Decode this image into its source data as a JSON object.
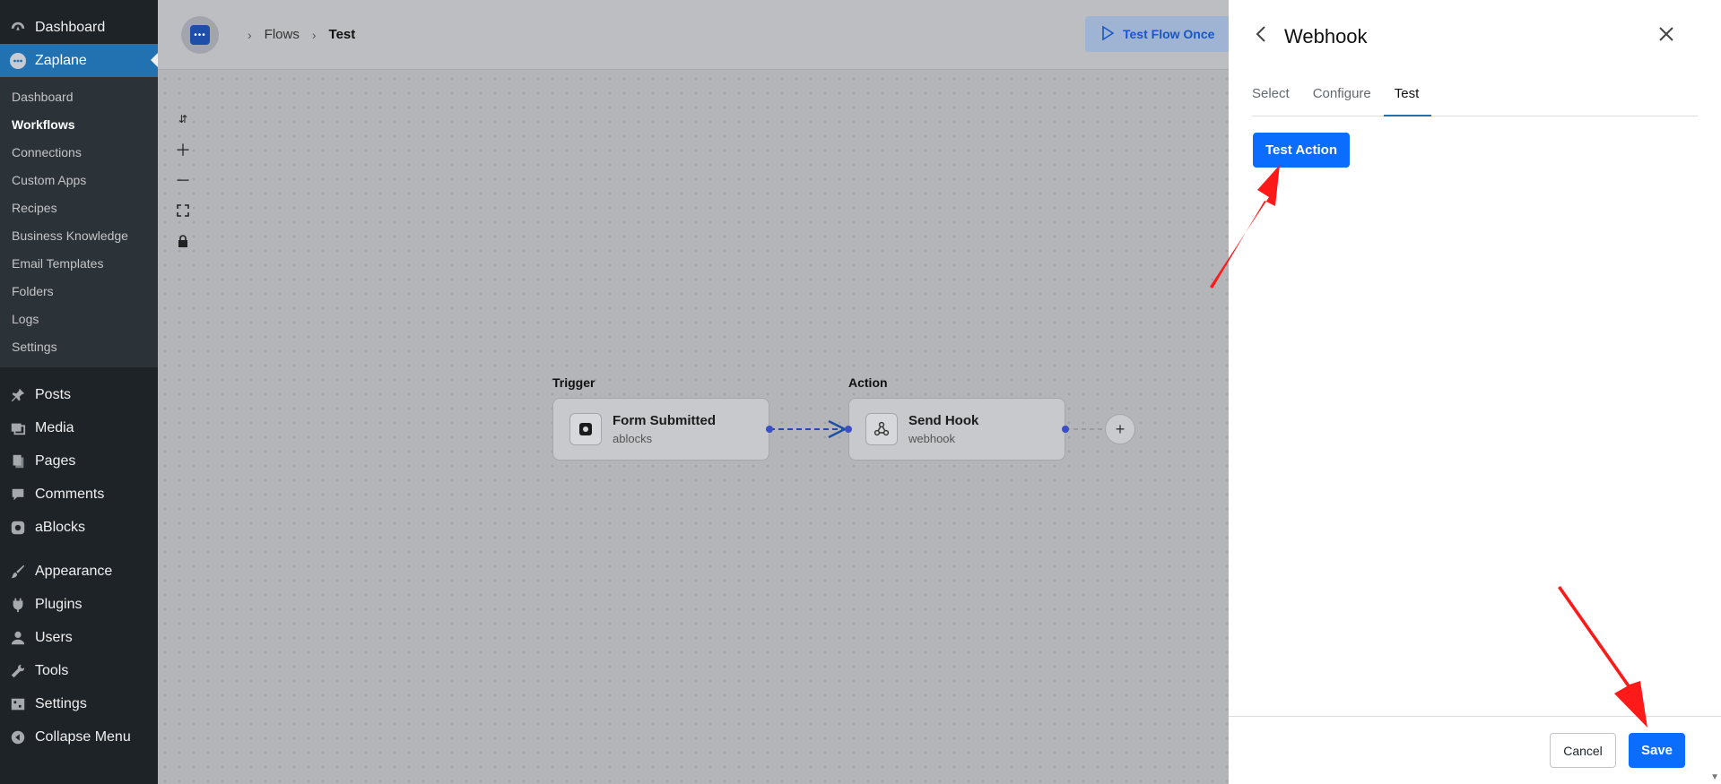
{
  "sidebar": {
    "top_items": [
      {
        "label": "Dashboard",
        "icon": "dashboard-icon"
      },
      {
        "label": "Zaplane",
        "icon": "zaplane-icon"
      }
    ],
    "sub_items": [
      "Dashboard",
      "Workflows",
      "Connections",
      "Custom Apps",
      "Recipes",
      "Business Knowledge",
      "Email Templates",
      "Folders",
      "Logs",
      "Settings"
    ],
    "bottom_items": [
      {
        "label": "Posts",
        "icon": "pin-icon"
      },
      {
        "label": "Media",
        "icon": "media-icon"
      },
      {
        "label": "Pages",
        "icon": "pages-icon"
      },
      {
        "label": "Comments",
        "icon": "comment-icon"
      },
      {
        "label": "aBlocks",
        "icon": "ablocks-icon"
      },
      {
        "label": "Appearance",
        "icon": "brush-icon"
      },
      {
        "label": "Plugins",
        "icon": "plug-icon"
      },
      {
        "label": "Users",
        "icon": "user-icon"
      },
      {
        "label": "Tools",
        "icon": "wrench-icon"
      },
      {
        "label": "Settings",
        "icon": "settings-icon"
      },
      {
        "label": "Collapse Menu",
        "icon": "collapse-icon"
      }
    ]
  },
  "breadcrumb": {
    "flows": "Flows",
    "current": "Test"
  },
  "toolbar": {
    "test_flow_once": "Test Flow Once"
  },
  "canvas": {
    "trigger_label": "Trigger",
    "action_label": "Action",
    "trigger_node": {
      "title": "Form Submitted",
      "subtitle": "ablocks"
    },
    "action_node": {
      "title": "Send Hook",
      "subtitle": "webhook"
    },
    "add_glyph": "+"
  },
  "panel": {
    "title": "Webhook",
    "tabs": [
      "Select",
      "Configure",
      "Test"
    ],
    "active_tab": "Test",
    "test_action": "Test Action",
    "cancel": "Cancel",
    "save": "Save"
  },
  "colors": {
    "accent": "#0b6dfd",
    "wp_sidebar": "#1d2327",
    "wp_current": "#2271b1",
    "annotation": "#ff1a1a"
  }
}
